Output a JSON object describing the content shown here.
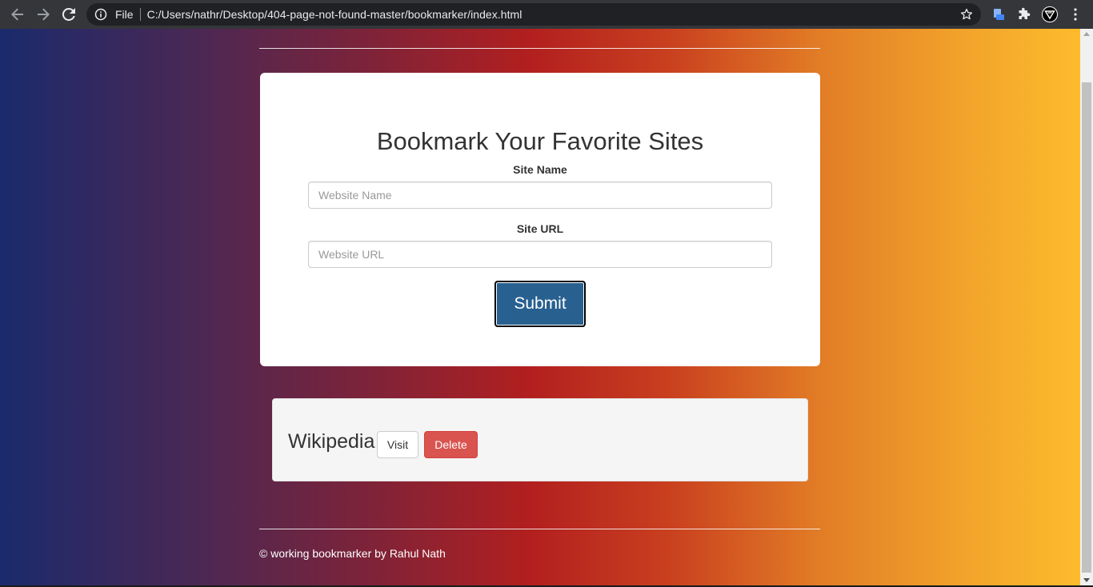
{
  "browser": {
    "omnibox_scheme": "File",
    "url": "C:/Users/nathr/Desktop/404-page-not-found-master/bookmarker/index.html"
  },
  "form": {
    "title": "Bookmark Your Favorite Sites",
    "site_name_label": "Site Name",
    "site_name_placeholder": "Website Name",
    "site_url_label": "Site URL",
    "site_url_placeholder": "Website URL",
    "submit_label": "Submit"
  },
  "bookmarks": [
    {
      "name": "Wikipedia",
      "visit_label": "Visit",
      "delete_label": "Delete"
    }
  ],
  "footer": {
    "text": "© working bookmarker by Rahul Nath"
  },
  "colors": {
    "submit_bg": "#286090",
    "delete_bg": "#d9534f",
    "gradient_left": "#1a2a6c",
    "gradient_mid": "#b21f1f",
    "gradient_right": "#fdbb2d"
  }
}
